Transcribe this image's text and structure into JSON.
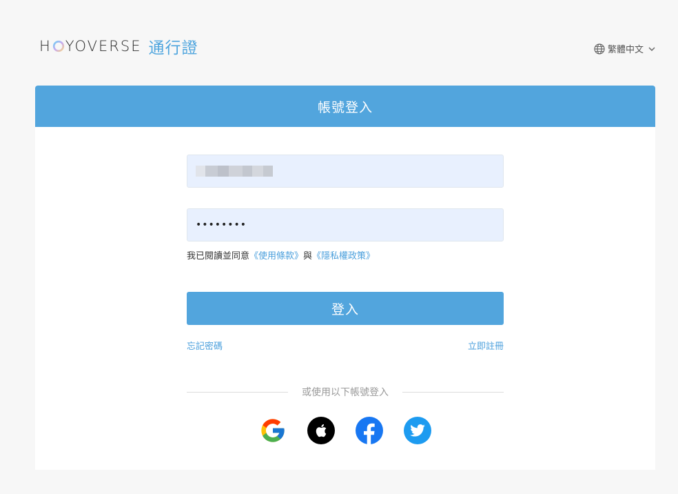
{
  "header": {
    "brand": "HOYOVERSE",
    "brand_prefix": "H",
    "brand_suffix": "YOVERSE",
    "pass": "通行證",
    "language": "繁體中文"
  },
  "card": {
    "title": "帳號登入",
    "password_value": "••••••••",
    "agree_prefix": "我已閱讀並同意",
    "terms_link": "《使用條款》",
    "agree_and": "與",
    "privacy_link": "《隱私權政策》",
    "login_label": "登入",
    "forgot_password": "忘記密碼",
    "register": "立即註冊",
    "divider_text": "或使用以下帳號登入"
  },
  "social": {
    "providers": [
      "google-icon",
      "apple-icon",
      "facebook-icon",
      "twitter-icon"
    ]
  },
  "colors": {
    "accent": "#52a5dd",
    "link": "#4a9fdc",
    "field_bg": "#e8f0fe",
    "page_bg": "#f7f7f7"
  }
}
